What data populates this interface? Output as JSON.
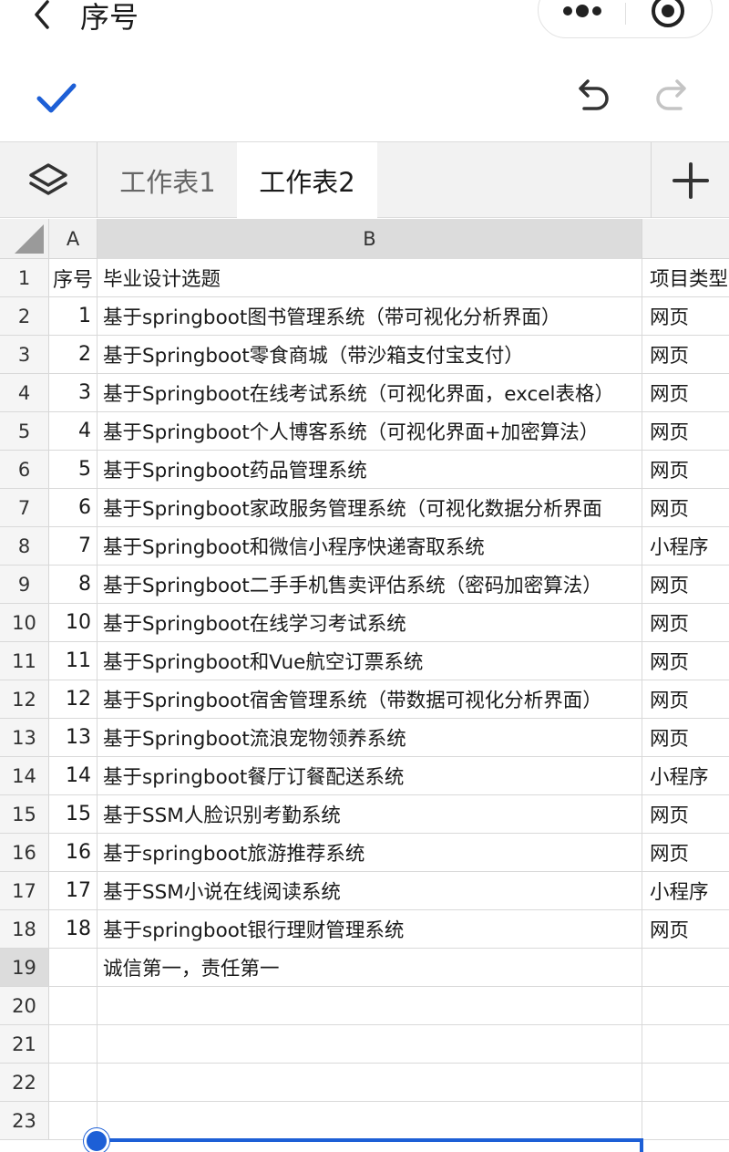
{
  "nav": {
    "title": "序号"
  },
  "tabs": [
    {
      "label": "工作表1",
      "active": false
    },
    {
      "label": "工作表2",
      "active": true
    }
  ],
  "columns": [
    "A",
    "B"
  ],
  "col_c_partial": "项目类型",
  "rows": [
    {
      "n": "1",
      "a": "序号",
      "b": "毕业设计选题",
      "c": "项目类型",
      "header": true
    },
    {
      "n": "2",
      "a": "1",
      "b": "基于springboot图书管理系统（带可视化分析界面）",
      "c": "网页"
    },
    {
      "n": "3",
      "a": "2",
      "b": "基于Springboot零食商城（带沙箱支付宝支付）",
      "c": "网页"
    },
    {
      "n": "4",
      "a": "3",
      "b": "基于Springboot在线考试系统（可视化界面，excel表格）",
      "c": "网页"
    },
    {
      "n": "5",
      "a": "4",
      "b": "基于Springboot个人博客系统（可视化界面+加密算法）",
      "c": "网页"
    },
    {
      "n": "6",
      "a": "5",
      "b": "基于Springboot药品管理系统",
      "c": "网页"
    },
    {
      "n": "7",
      "a": "6",
      "b": "基于Springboot家政服务管理系统（可视化数据分析界面",
      "c": "网页"
    },
    {
      "n": "8",
      "a": "7",
      "b": "基于Springboot和微信小程序快递寄取系统",
      "c": "小程序"
    },
    {
      "n": "9",
      "a": "8",
      "b": "基于Springboot二手手机售卖评估系统（密码加密算法）",
      "c": "网页"
    },
    {
      "n": "10",
      "a": "10",
      "b": "基于Springboot在线学习考试系统",
      "c": "网页"
    },
    {
      "n": "11",
      "a": "11",
      "b": "基于Springboot和Vue航空订票系统",
      "c": "网页"
    },
    {
      "n": "12",
      "a": "12",
      "b": "基于Springboot宿舍管理系统（带数据可视化分析界面）",
      "c": "网页"
    },
    {
      "n": "13",
      "a": "13",
      "b": "基于Springboot流浪宠物领养系统",
      "c": "网页"
    },
    {
      "n": "14",
      "a": "14",
      "b": "基于springboot餐厅订餐配送系统",
      "c": "小程序"
    },
    {
      "n": "15",
      "a": "15",
      "b": "基于SSM人脸识别考勤系统",
      "c": "网页"
    },
    {
      "n": "16",
      "a": "16",
      "b": "基于springboot旅游推荐系统",
      "c": "网页"
    },
    {
      "n": "17",
      "a": "17",
      "b": "基于SSM小说在线阅读系统",
      "c": "小程序"
    },
    {
      "n": "18",
      "a": "18",
      "b": "基于springboot银行理财管理系统",
      "c": "网页"
    },
    {
      "n": "19",
      "a": "",
      "b": "诚信第一，责任第一",
      "c": "",
      "selected": true
    },
    {
      "n": "20",
      "a": "",
      "b": "",
      "c": ""
    },
    {
      "n": "21",
      "a": "",
      "b": "",
      "c": ""
    },
    {
      "n": "22",
      "a": "",
      "b": "",
      "c": ""
    },
    {
      "n": "23",
      "a": "",
      "b": "",
      "c": ""
    }
  ],
  "colors": {
    "accent": "#1d5fd6",
    "tab_bg": "#f2f2f2",
    "header_bg": "#f1f1f1"
  },
  "icons": [
    "back-icon",
    "more-icon",
    "close-capsule-icon",
    "confirm-check-icon",
    "undo-icon",
    "redo-icon",
    "layers-icon",
    "add-sheet-icon"
  ]
}
